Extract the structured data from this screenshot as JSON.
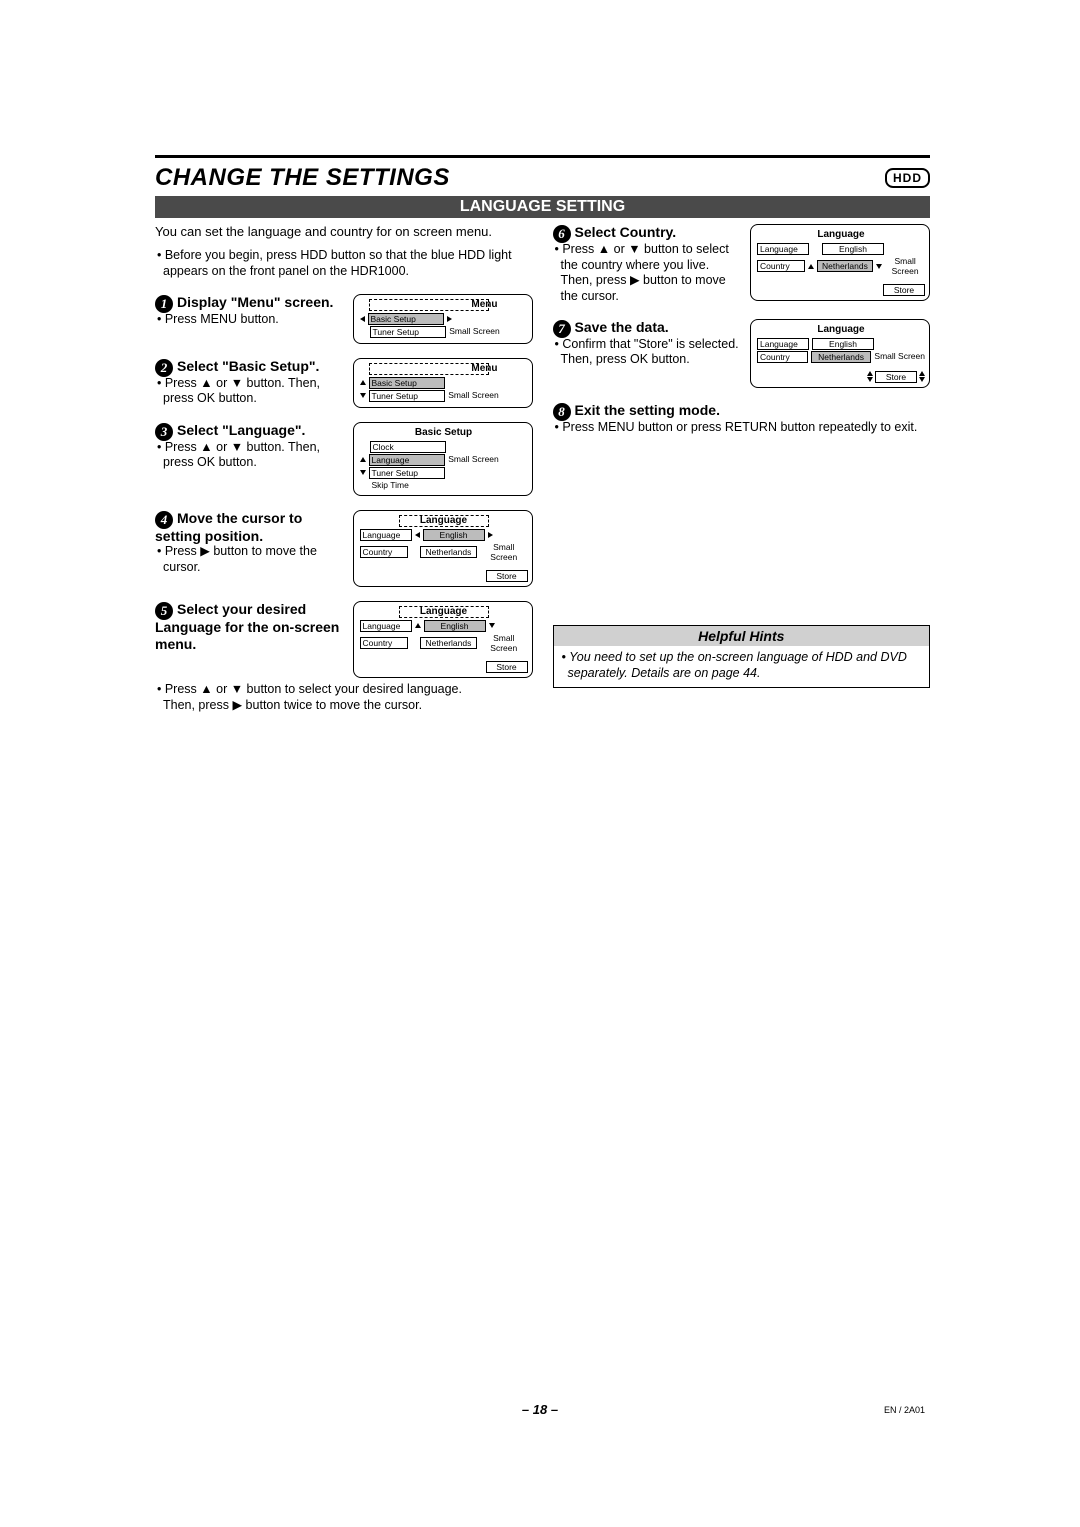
{
  "chapter_title": "CHANGE THE SETTINGS",
  "hdd_badge": "HDD",
  "section_bar": "LANGUAGE SETTING",
  "intro": "You can set the language and country for on screen menu.",
  "intro_bullet": "• Before you begin, press HDD button so that the blue HDD light appears on the front panel on the HDR1000.",
  "steps_left": [
    {
      "num": "1",
      "heading": "Display \"Menu\" screen.",
      "desc": "• Press MENU button.",
      "osd": {
        "title": "Menu",
        "rows": [
          {
            "label": "Basic Setup",
            "hl": true,
            "sel": true,
            "arrow": "lr"
          },
          {
            "label": "Tuner Setup",
            "sel": true
          }
        ],
        "side": "Small Screen"
      }
    },
    {
      "num": "2",
      "heading": "Select \"Basic Setup\".",
      "desc": "• Press ▲ or ▼ button. Then, press OK button.",
      "osd": {
        "title": "Menu",
        "rows": [
          {
            "label": "Basic Setup",
            "hl": true,
            "arrow": "ud"
          },
          {
            "label": "Tuner Setup",
            "sel": true
          }
        ],
        "side": "Small Screen"
      }
    },
    {
      "num": "3",
      "heading": "Select \"Language\".",
      "desc": "• Press ▲ or ▼ button. Then, press OK button.",
      "osd": {
        "title": "Basic Setup",
        "list": [
          "Clock",
          "Language",
          "Tuner Setup",
          "Skip Time"
        ],
        "hl_index": 1,
        "side": "Small Screen"
      }
    },
    {
      "num": "4",
      "heading": "Move the cursor to setting position.",
      "desc": "• Press ▶ button to move the cursor.",
      "osd": {
        "title": "Language",
        "rows2": [
          {
            "label": "Language",
            "val": "English",
            "hl": true
          },
          {
            "label": "Country",
            "val": "Netherlands",
            "sel": true
          }
        ],
        "side": "Small Screen",
        "store": "Store"
      }
    },
    {
      "num": "5",
      "heading": "Select your desired Language for the on-screen menu.",
      "desc": "• Press ▲ or ▼ button to select your desired language.\nThen, press ▶ button twice to move the cursor.",
      "osd": {
        "title": "Language",
        "rows2": [
          {
            "label": "Language",
            "val": "English",
            "hl": true,
            "arrow": "ud"
          },
          {
            "label": "Country",
            "val": "Netherlands",
            "sel": true
          }
        ],
        "side": "Small Screen",
        "store": "Store"
      }
    }
  ],
  "steps_right": [
    {
      "num": "6",
      "heading": "Select Country.",
      "desc": "• Press ▲ or ▼ button to select the country where you live.\nThen, press ▶ button to move the cursor.",
      "osd": {
        "title": "Language",
        "rows2": [
          {
            "label": "Language",
            "val": "English",
            "sel": true
          },
          {
            "label": "Country",
            "val": "Netherlands",
            "hl": true,
            "arrow": "ud-r"
          }
        ],
        "side": "Small Screen",
        "store": "Store"
      }
    },
    {
      "num": "7",
      "heading": "Save the data.",
      "desc": "• Confirm that \"Store\" is selected.\nThen, press OK button.",
      "osd": {
        "title": "Language",
        "rows2": [
          {
            "label": "Language",
            "val": "English"
          },
          {
            "label": "Country",
            "val": "Netherlands",
            "hl": true
          }
        ],
        "side": "Small Screen",
        "store": "Store",
        "store_sel": true
      }
    },
    {
      "num": "8",
      "heading": "Exit the setting mode.",
      "desc": "• Press MENU button or press RETURN button repeatedly to exit."
    }
  ],
  "hints": {
    "title": "Helpful Hints",
    "body": "• You need to set up the on-screen language of HDD and DVD separately. Details are on page 44."
  },
  "page_number": "– 18 –",
  "doc_code": "EN / 2A01"
}
